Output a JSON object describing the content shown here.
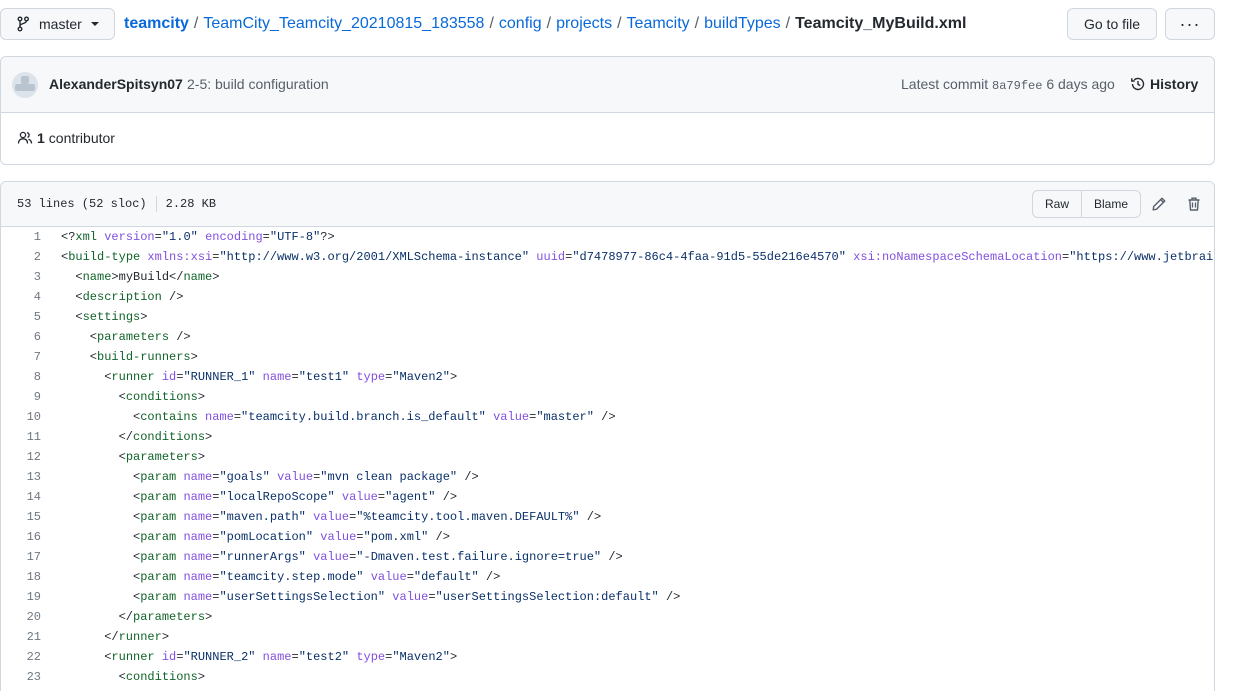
{
  "branch": {
    "name": "master"
  },
  "breadcrumb": {
    "repo": "teamcity",
    "segments": [
      "TeamCity_Teamcity_20210815_183558",
      "config",
      "projects",
      "Teamcity",
      "buildTypes"
    ],
    "file": "Teamcity_MyBuild.xml",
    "separator": "/"
  },
  "actions": {
    "goto_file": "Go to file",
    "more": "···"
  },
  "commit": {
    "author": "AlexanderSpitsyn07",
    "message": "2-5: build configuration",
    "latest_label": "Latest commit",
    "sha": "8a79fee",
    "age": "6 days ago",
    "history_label": "History"
  },
  "contributors": {
    "count": "1",
    "label": "contributor"
  },
  "file": {
    "lines_info": "53 lines (52 sloc)",
    "size": "2.28 KB",
    "raw_label": "Raw",
    "blame_label": "Blame"
  },
  "code_lines": [
    [
      [
        "punc",
        "<?"
      ],
      [
        "tag",
        "xml"
      ],
      [
        "punc",
        " "
      ],
      [
        "attr",
        "version"
      ],
      [
        "punc",
        "="
      ],
      [
        "str",
        "\"1.0\""
      ],
      [
        "punc",
        " "
      ],
      [
        "attr",
        "encoding"
      ],
      [
        "punc",
        "="
      ],
      [
        "str",
        "\"UTF-8\""
      ],
      [
        "punc",
        "?>"
      ]
    ],
    [
      [
        "punc",
        "<"
      ],
      [
        "tag",
        "build-type"
      ],
      [
        "punc",
        " "
      ],
      [
        "attr",
        "xmlns:xsi"
      ],
      [
        "punc",
        "="
      ],
      [
        "str",
        "\"http://www.w3.org/2001/XMLSchema-instance\""
      ],
      [
        "punc",
        " "
      ],
      [
        "attr",
        "uuid"
      ],
      [
        "punc",
        "="
      ],
      [
        "str",
        "\"d7478977-86c4-4faa-91d5-55de216e4570\""
      ],
      [
        "punc",
        " "
      ],
      [
        "attr",
        "xsi:noNamespaceSchemaLocation"
      ],
      [
        "punc",
        "="
      ],
      [
        "str",
        "\"https://www.jetbrains"
      ]
    ],
    [
      [
        "punc",
        "  <"
      ],
      [
        "tag",
        "name"
      ],
      [
        "punc",
        ">myBuild</"
      ],
      [
        "tag",
        "name"
      ],
      [
        "punc",
        ">"
      ]
    ],
    [
      [
        "punc",
        "  <"
      ],
      [
        "tag",
        "description"
      ],
      [
        "punc",
        " />"
      ]
    ],
    [
      [
        "punc",
        "  <"
      ],
      [
        "tag",
        "settings"
      ],
      [
        "punc",
        ">"
      ]
    ],
    [
      [
        "punc",
        "    <"
      ],
      [
        "tag",
        "parameters"
      ],
      [
        "punc",
        " />"
      ]
    ],
    [
      [
        "punc",
        "    <"
      ],
      [
        "tag",
        "build-runners"
      ],
      [
        "punc",
        ">"
      ]
    ],
    [
      [
        "punc",
        "      <"
      ],
      [
        "tag",
        "runner"
      ],
      [
        "punc",
        " "
      ],
      [
        "attr",
        "id"
      ],
      [
        "punc",
        "="
      ],
      [
        "str",
        "\"RUNNER_1\""
      ],
      [
        "punc",
        " "
      ],
      [
        "attr",
        "name"
      ],
      [
        "punc",
        "="
      ],
      [
        "str",
        "\"test1\""
      ],
      [
        "punc",
        " "
      ],
      [
        "attr",
        "type"
      ],
      [
        "punc",
        "="
      ],
      [
        "str",
        "\"Maven2\""
      ],
      [
        "punc",
        ">"
      ]
    ],
    [
      [
        "punc",
        "        <"
      ],
      [
        "tag",
        "conditions"
      ],
      [
        "punc",
        ">"
      ]
    ],
    [
      [
        "punc",
        "          <"
      ],
      [
        "tag",
        "contains"
      ],
      [
        "punc",
        " "
      ],
      [
        "attr",
        "name"
      ],
      [
        "punc",
        "="
      ],
      [
        "str",
        "\"teamcity.build.branch.is_default\""
      ],
      [
        "punc",
        " "
      ],
      [
        "attr",
        "value"
      ],
      [
        "punc",
        "="
      ],
      [
        "str",
        "\"master\""
      ],
      [
        "punc",
        " />"
      ]
    ],
    [
      [
        "punc",
        "        </"
      ],
      [
        "tag",
        "conditions"
      ],
      [
        "punc",
        ">"
      ]
    ],
    [
      [
        "punc",
        "        <"
      ],
      [
        "tag",
        "parameters"
      ],
      [
        "punc",
        ">"
      ]
    ],
    [
      [
        "punc",
        "          <"
      ],
      [
        "tag",
        "param"
      ],
      [
        "punc",
        " "
      ],
      [
        "attr",
        "name"
      ],
      [
        "punc",
        "="
      ],
      [
        "str",
        "\"goals\""
      ],
      [
        "punc",
        " "
      ],
      [
        "attr",
        "value"
      ],
      [
        "punc",
        "="
      ],
      [
        "str",
        "\"mvn clean package\""
      ],
      [
        "punc",
        " />"
      ]
    ],
    [
      [
        "punc",
        "          <"
      ],
      [
        "tag",
        "param"
      ],
      [
        "punc",
        " "
      ],
      [
        "attr",
        "name"
      ],
      [
        "punc",
        "="
      ],
      [
        "str",
        "\"localRepoScope\""
      ],
      [
        "punc",
        " "
      ],
      [
        "attr",
        "value"
      ],
      [
        "punc",
        "="
      ],
      [
        "str",
        "\"agent\""
      ],
      [
        "punc",
        " />"
      ]
    ],
    [
      [
        "punc",
        "          <"
      ],
      [
        "tag",
        "param"
      ],
      [
        "punc",
        " "
      ],
      [
        "attr",
        "name"
      ],
      [
        "punc",
        "="
      ],
      [
        "str",
        "\"maven.path\""
      ],
      [
        "punc",
        " "
      ],
      [
        "attr",
        "value"
      ],
      [
        "punc",
        "="
      ],
      [
        "str",
        "\"%teamcity.tool.maven.DEFAULT%\""
      ],
      [
        "punc",
        " />"
      ]
    ],
    [
      [
        "punc",
        "          <"
      ],
      [
        "tag",
        "param"
      ],
      [
        "punc",
        " "
      ],
      [
        "attr",
        "name"
      ],
      [
        "punc",
        "="
      ],
      [
        "str",
        "\"pomLocation\""
      ],
      [
        "punc",
        " "
      ],
      [
        "attr",
        "value"
      ],
      [
        "punc",
        "="
      ],
      [
        "str",
        "\"pom.xml\""
      ],
      [
        "punc",
        " />"
      ]
    ],
    [
      [
        "punc",
        "          <"
      ],
      [
        "tag",
        "param"
      ],
      [
        "punc",
        " "
      ],
      [
        "attr",
        "name"
      ],
      [
        "punc",
        "="
      ],
      [
        "str",
        "\"runnerArgs\""
      ],
      [
        "punc",
        " "
      ],
      [
        "attr",
        "value"
      ],
      [
        "punc",
        "="
      ],
      [
        "str",
        "\"-Dmaven.test.failure.ignore=true\""
      ],
      [
        "punc",
        " />"
      ]
    ],
    [
      [
        "punc",
        "          <"
      ],
      [
        "tag",
        "param"
      ],
      [
        "punc",
        " "
      ],
      [
        "attr",
        "name"
      ],
      [
        "punc",
        "="
      ],
      [
        "str",
        "\"teamcity.step.mode\""
      ],
      [
        "punc",
        " "
      ],
      [
        "attr",
        "value"
      ],
      [
        "punc",
        "="
      ],
      [
        "str",
        "\"default\""
      ],
      [
        "punc",
        " />"
      ]
    ],
    [
      [
        "punc",
        "          <"
      ],
      [
        "tag",
        "param"
      ],
      [
        "punc",
        " "
      ],
      [
        "attr",
        "name"
      ],
      [
        "punc",
        "="
      ],
      [
        "str",
        "\"userSettingsSelection\""
      ],
      [
        "punc",
        " "
      ],
      [
        "attr",
        "value"
      ],
      [
        "punc",
        "="
      ],
      [
        "str",
        "\"userSettingsSelection:default\""
      ],
      [
        "punc",
        " />"
      ]
    ],
    [
      [
        "punc",
        "        </"
      ],
      [
        "tag",
        "parameters"
      ],
      [
        "punc",
        ">"
      ]
    ],
    [
      [
        "punc",
        "      </"
      ],
      [
        "tag",
        "runner"
      ],
      [
        "punc",
        ">"
      ]
    ],
    [
      [
        "punc",
        "      <"
      ],
      [
        "tag",
        "runner"
      ],
      [
        "punc",
        " "
      ],
      [
        "attr",
        "id"
      ],
      [
        "punc",
        "="
      ],
      [
        "str",
        "\"RUNNER_2\""
      ],
      [
        "punc",
        " "
      ],
      [
        "attr",
        "name"
      ],
      [
        "punc",
        "="
      ],
      [
        "str",
        "\"test2\""
      ],
      [
        "punc",
        " "
      ],
      [
        "attr",
        "type"
      ],
      [
        "punc",
        "="
      ],
      [
        "str",
        "\"Maven2\""
      ],
      [
        "punc",
        ">"
      ]
    ],
    [
      [
        "punc",
        "        <"
      ],
      [
        "tag",
        "conditions"
      ],
      [
        "punc",
        ">"
      ]
    ]
  ]
}
